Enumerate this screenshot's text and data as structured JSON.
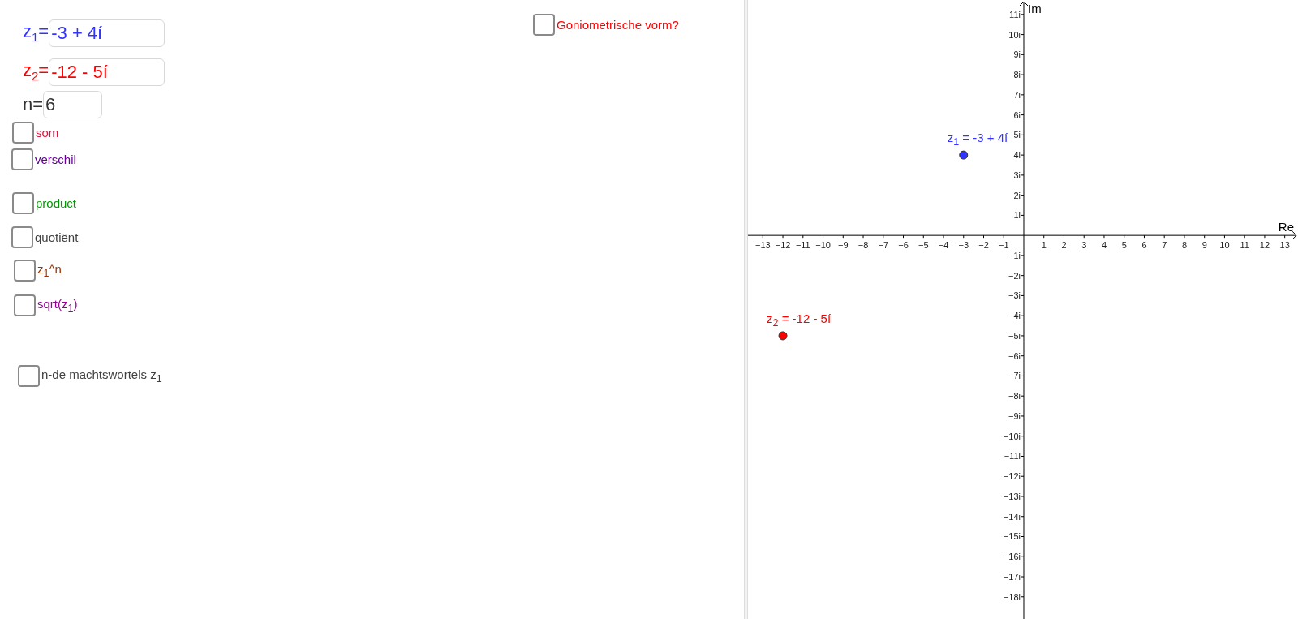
{
  "inputs": [
    {
      "label": "z$_{1}$=",
      "value": "-3 + 4í",
      "color": "#3333ff"
    },
    {
      "label": "z$_{2}$=",
      "value": "-12 - 5í",
      "color": "#ff0000"
    },
    {
      "label": "n=",
      "value": "6",
      "color": "#333333"
    }
  ],
  "checkboxes": [
    {
      "label": "som",
      "checked": false,
      "color": "#dc143c"
    },
    {
      "label": "verschil",
      "checked": false,
      "color": "#660099"
    },
    {
      "label": "product",
      "checked": false,
      "color": "#009900"
    },
    {
      "label": "quotiënt",
      "checked": false,
      "color": "#404040"
    },
    {
      "label": "z$_{1}$^n",
      "checked": false,
      "color": "#993300"
    },
    {
      "label": "sqrt(z$_{1}$)",
      "checked": false,
      "color": "#990099"
    },
    {
      "label": "n-de machtswortels z$_{1}$",
      "checked": false,
      "color": "#404040"
    }
  ],
  "toggle": {
    "label": "Goniometrische vorm?",
    "checked": false
  },
  "graph": {
    "chart_data": {
      "type": "scatter",
      "xlabel": "Re",
      "ylabel": "Im",
      "xlim": [
        -13.74,
        13.66
      ],
      "ylim": [
        -19.1,
        11.72
      ],
      "xticks": [
        {
          "value": -13,
          "label": "−13"
        },
        {
          "value": -12,
          "label": "−12"
        },
        {
          "value": -11,
          "label": "−11"
        },
        {
          "value": -10,
          "label": "−10"
        },
        {
          "value": -9,
          "label": "−9"
        },
        {
          "value": -8,
          "label": "−8"
        },
        {
          "value": -7,
          "label": "−7"
        },
        {
          "value": -6,
          "label": "−6"
        },
        {
          "value": -5,
          "label": "−5"
        },
        {
          "value": -4,
          "label": "−4"
        },
        {
          "value": -3,
          "label": "−3"
        },
        {
          "value": -2,
          "label": "−2"
        },
        {
          "value": -1,
          "label": "−1"
        },
        1,
        2,
        3,
        4,
        5,
        6,
        7,
        8,
        9,
        10,
        11,
        12,
        13
      ],
      "yticks": [
        {
          "value": 11,
          "label": "11i"
        },
        {
          "value": 10,
          "label": "10i"
        },
        {
          "value": 9,
          "label": "9i"
        },
        {
          "value": 8,
          "label": "8i"
        },
        {
          "value": 7,
          "label": "7i"
        },
        {
          "value": 6,
          "label": "6i"
        },
        {
          "value": 5,
          "label": "5i"
        },
        {
          "value": 4,
          "label": "4i"
        },
        {
          "value": 3,
          "label": "3i"
        },
        {
          "value": 2,
          "label": "2i"
        },
        {
          "value": 1,
          "label": "1i"
        },
        {
          "value": -1,
          "label": "−1i"
        },
        {
          "value": -2,
          "label": "−2i"
        },
        {
          "value": -3,
          "label": "−3i"
        },
        {
          "value": -4,
          "label": "−4i"
        },
        {
          "value": -5,
          "label": "−5i"
        },
        {
          "value": -6,
          "label": "−6i"
        },
        {
          "value": -7,
          "label": "−7i"
        },
        {
          "value": -8,
          "label": "−8i"
        },
        {
          "value": -9,
          "label": "−9i"
        },
        {
          "value": -10,
          "label": "−10i"
        },
        {
          "value": -11,
          "label": "−11i"
        },
        {
          "value": -12,
          "label": "−12i"
        },
        {
          "value": -13,
          "label": "−13i"
        },
        {
          "value": -14,
          "label": "−14i"
        },
        {
          "value": -15,
          "label": "−15i"
        },
        {
          "value": -16,
          "label": "−16i"
        },
        {
          "value": -17,
          "label": "−17i"
        },
        {
          "value": -18,
          "label": "−18i"
        }
      ],
      "series": [
        {
          "name": "z$_{1}$ = -3 + 4í",
          "color": "#3333ff",
          "x": [
            -3
          ],
          "values": [
            4
          ]
        },
        {
          "name": "z$_{2}$ = -12 - 5í",
          "color": "#ff0000",
          "x": [
            -12
          ],
          "values": [
            -5
          ]
        }
      ]
    }
  }
}
